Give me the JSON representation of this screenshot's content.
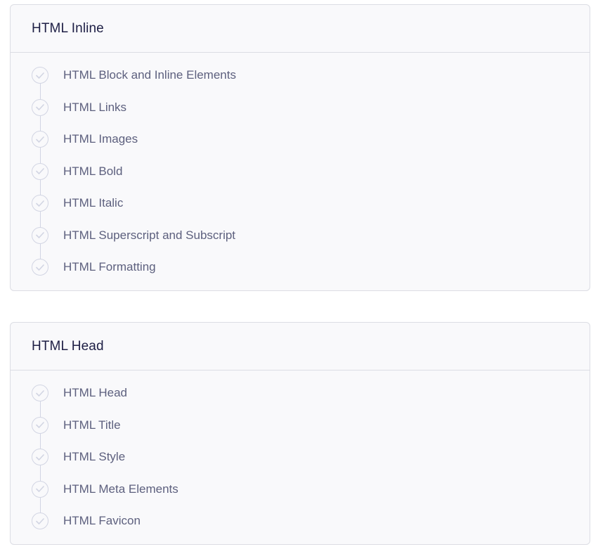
{
  "sections": [
    {
      "title": "HTML Inline",
      "lessons": [
        "HTML Block and Inline Elements",
        "HTML Links",
        "HTML Images",
        "HTML Bold",
        "HTML Italic",
        "HTML Superscript and Subscript",
        "HTML Formatting"
      ]
    },
    {
      "title": "HTML Head",
      "lessons": [
        "HTML Head",
        "HTML Title",
        "HTML Style",
        "HTML Meta Elements",
        "HTML Favicon"
      ]
    }
  ],
  "icons": {
    "lesson_status": "check-circle-icon"
  },
  "colors": {
    "card_background": "#f9f9fb",
    "border": "#dcdde4",
    "title_text": "#1e1f45",
    "lesson_text": "#5d607e",
    "check_outline": "#d2d5e3"
  }
}
